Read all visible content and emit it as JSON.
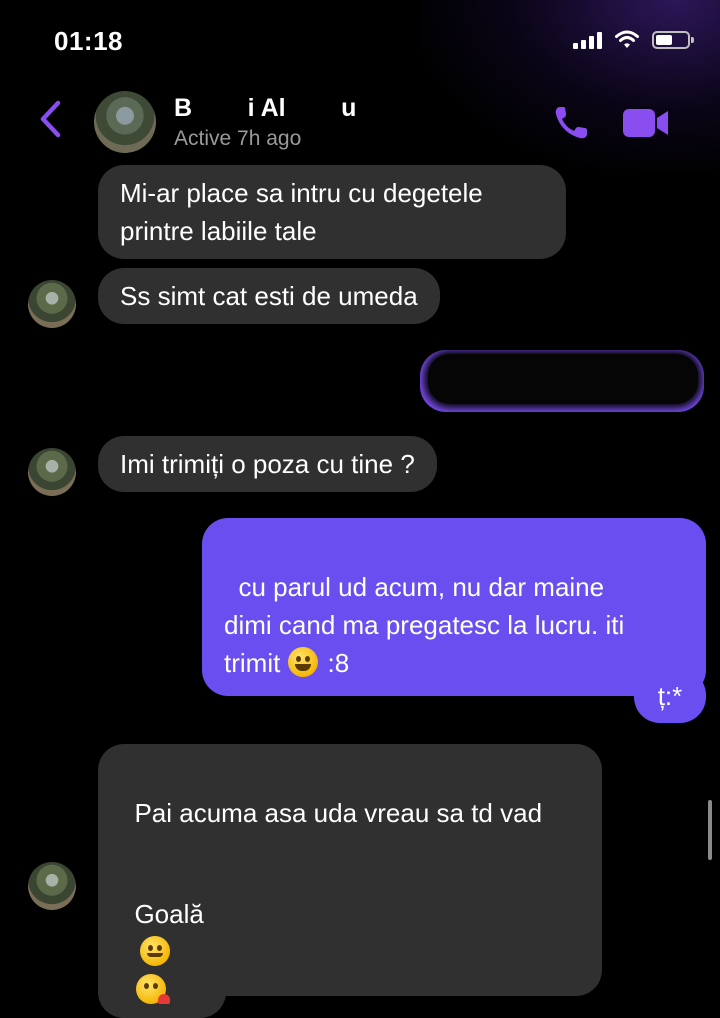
{
  "status_bar": {
    "time": "01:18"
  },
  "header": {
    "contact_name": "B        i Al        u",
    "contact_status": "Active 7h ago"
  },
  "messages": [
    {
      "text": "Mi-ar place sa intru cu degetele\nprintre labiile tale"
    },
    {
      "text": "Ss simt cat esti de umeda"
    },
    {
      "text": "Imi trimiți o poza cu tine ?"
    },
    {
      "text": "cu parul ud acum, nu dar maine\ndimi cand ma pregatesc la lucru. iti\ntrimit",
      "suffix": " :8"
    },
    {
      "text": "ț:*"
    },
    {
      "text": "Pai acuma asa uda vreau sa td vad"
    },
    {
      "text": "Goală"
    }
  ],
  "colors": {
    "accent": "#8a4df0",
    "outgoing_bubble": "#6b4ef0",
    "incoming_bubble": "#303030"
  },
  "icons": [
    "back-chevron-icon",
    "phone-icon",
    "video-camera-icon",
    "grinning-emoji",
    "winking-emoji",
    "kissing-emoji"
  ]
}
